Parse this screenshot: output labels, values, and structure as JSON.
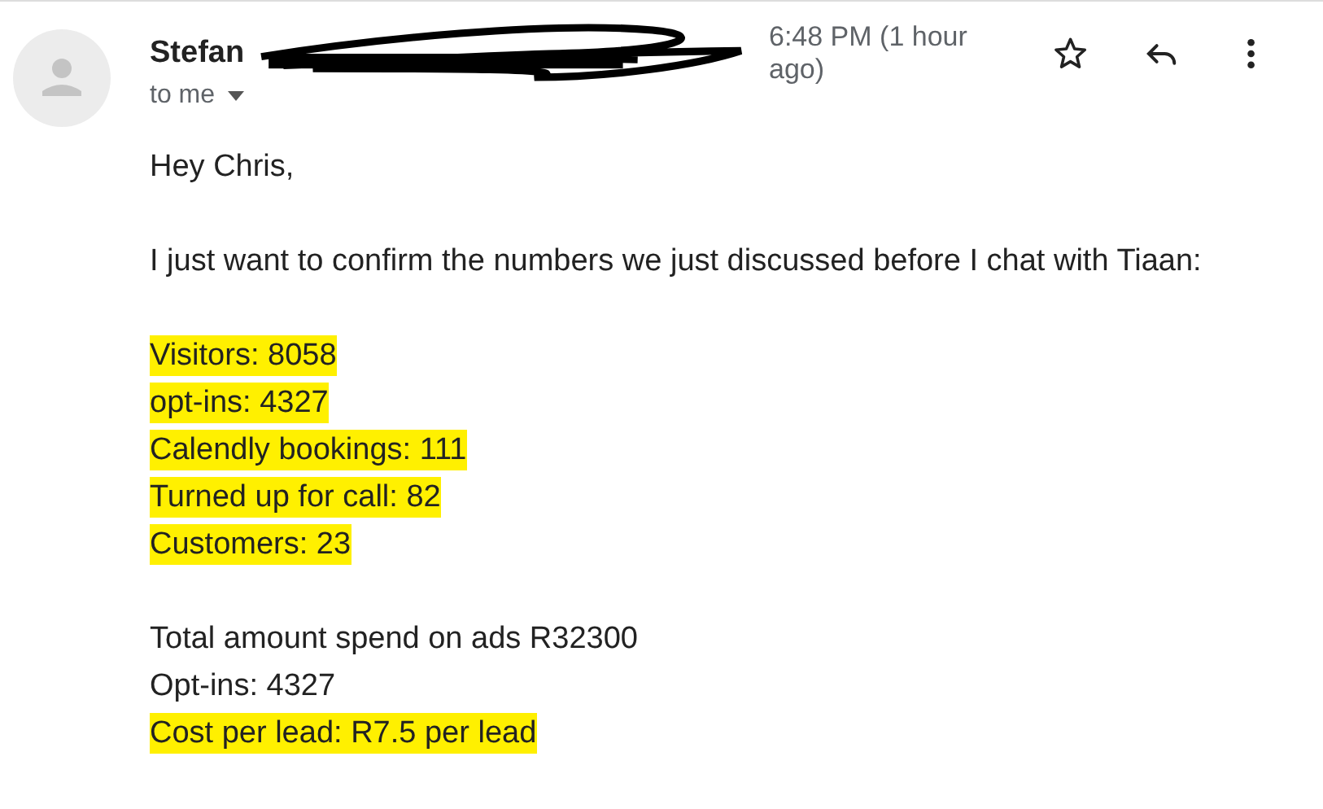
{
  "sender": {
    "name": "Stefan",
    "redacted": true,
    "time": "6:48 PM (1 hour ago)",
    "recipient": "to me"
  },
  "paragraphs": [
    {
      "lines": [
        {
          "text": "Hey Chris,",
          "highlighted": false
        }
      ]
    },
    {
      "lines": [
        {
          "text": "I just want to confirm the numbers we just discussed before I chat with Tiaan:",
          "highlighted": false
        }
      ]
    },
    {
      "lines": [
        {
          "text": "Visitors: 8058",
          "highlighted": true
        },
        {
          "text": "opt-ins: 4327",
          "highlighted": true
        },
        {
          "text": "Calendly bookings: 111",
          "highlighted": true
        },
        {
          "text": "Turned up for call: 82",
          "highlighted": true
        },
        {
          "text": "Customers: 23",
          "highlighted": true
        }
      ]
    },
    {
      "lines": [
        {
          "text": "Total amount spend on ads R32300",
          "highlighted": false
        },
        {
          "text": "Opt-ins: 4327",
          "highlighted": false
        },
        {
          "text": "Cost per lead: R7.5 per lead",
          "highlighted": true
        }
      ]
    }
  ]
}
